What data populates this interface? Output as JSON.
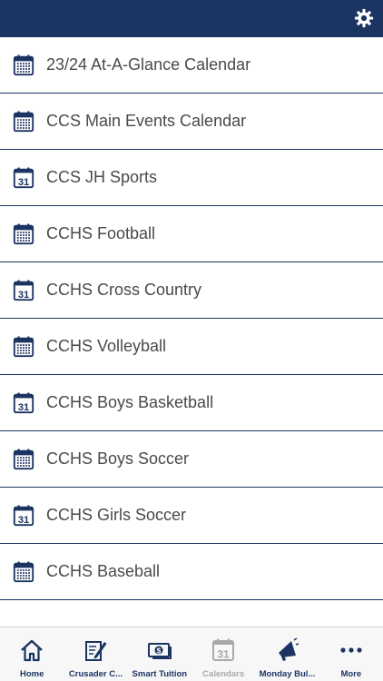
{
  "colors": {
    "primary": "#1b3462",
    "text": "#4a4a4a",
    "tab_inactive": "#a7a9ac",
    "tabbar_bg": "#f7f7f7"
  },
  "header": {
    "settings_icon": "gear-icon"
  },
  "calendars": [
    {
      "label": "23/24 At-A-Glance Calendar",
      "icon": "calendar-grid-icon"
    },
    {
      "label": "CCS Main Events Calendar",
      "icon": "calendar-grid-icon"
    },
    {
      "label": "CCS JH Sports",
      "icon": "calendar-31-icon",
      "icon_text": "31"
    },
    {
      "label": "CCHS Football",
      "icon": "calendar-grid-icon"
    },
    {
      "label": "CCHS Cross Country",
      "icon": "calendar-31-icon",
      "icon_text": "31"
    },
    {
      "label": "CCHS Volleyball",
      "icon": "calendar-grid-icon"
    },
    {
      "label": "CCHS Boys Basketball",
      "icon": "calendar-31-icon",
      "icon_text": "31"
    },
    {
      "label": "CCHS Boys Soccer",
      "icon": "calendar-grid-icon"
    },
    {
      "label": "CCHS Girls Soccer",
      "icon": "calendar-31-icon",
      "icon_text": "31"
    },
    {
      "label": "CCHS Baseball",
      "icon": "calendar-grid-icon"
    }
  ],
  "tabs": [
    {
      "label": "Home",
      "icon": "home-icon"
    },
    {
      "label": "Crusader C...",
      "icon": "notebook-pen-icon"
    },
    {
      "label": "Smart Tuition",
      "icon": "money-icon"
    },
    {
      "label": "Calendars",
      "icon": "calendar-31-icon",
      "icon_text": "31",
      "active": true
    },
    {
      "label": "Monday Bul...",
      "icon": "megaphone-icon"
    },
    {
      "label": "More",
      "icon": "more-dots-icon"
    }
  ]
}
